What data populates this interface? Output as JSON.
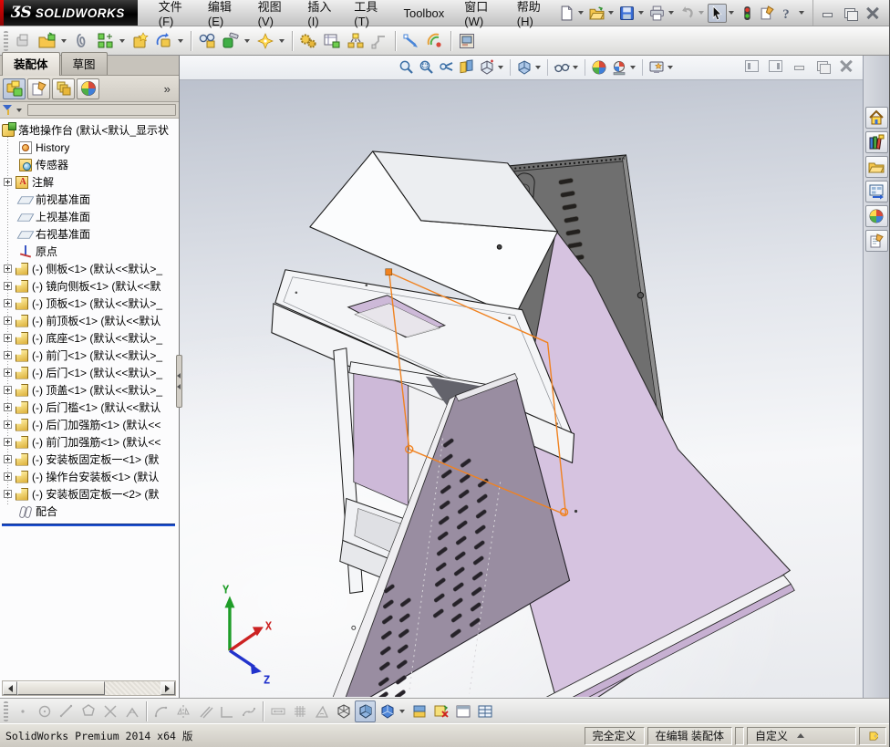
{
  "titlebar": {
    "logo_mark": "ƷS",
    "logo_text": "SOLIDWORKS",
    "menus": [
      "文件(F)",
      "编辑(E)",
      "视图(V)",
      "插入(I)",
      "工具(T)",
      "Toolbox",
      "窗口(W)",
      "帮助(H)"
    ]
  },
  "toolbars": {
    "standard": [
      "new-document",
      "open",
      "save",
      "print",
      "undo",
      "select",
      "rebuild",
      "file-properties",
      "help"
    ],
    "assembly": [
      "edit-component",
      "insert-components",
      "mate",
      "linear-component-pattern",
      "smart-fasteners",
      "move-component",
      "show-hidden-components",
      "assembly-features",
      "reference-geometry",
      "new-motion-study",
      "bill-of-materials",
      "exploded-view",
      "explode-line-sketch",
      "instant3d",
      "take-snapshot",
      "large-assembly-mode"
    ],
    "heads_up": [
      "zoom-to-fit",
      "zoom-to-area",
      "previous-view",
      "section-view",
      "view-orientation",
      "display-style",
      "hide-show-items",
      "edit-appearance",
      "apply-scene",
      "view-settings"
    ],
    "sketch_display": [
      "point",
      "circle",
      "line",
      "polygon",
      "trim-entities",
      "sketch-fillet",
      "tangent-arc",
      "mirror-entities",
      "offset-entities",
      "corner-rectangle",
      "spline",
      "smart-dimension",
      "grid-system",
      "measure",
      "wireframe",
      "shaded-with-edges",
      "view-cube",
      "section-view-toggle",
      "assembly-visualization",
      "task-pane-window",
      "split-table"
    ]
  },
  "command_tabs": [
    {
      "label": "装配体",
      "active": true
    },
    {
      "label": "草图",
      "active": false
    }
  ],
  "panel_more": "»",
  "panel_tabs": [
    "featuremanager-design-tree",
    "propertymanager",
    "configurationmanager",
    "displaymanager"
  ],
  "feature_tree": {
    "root_label": "落地操作台  (默认<默认_显示状",
    "items": [
      {
        "label": "History",
        "icon": "history"
      },
      {
        "label": "传感器",
        "icon": "sensors"
      },
      {
        "label": "注解",
        "icon": "annotations",
        "expandable": true
      },
      {
        "label": "前视基准面",
        "icon": "plane"
      },
      {
        "label": "上视基准面",
        "icon": "plane"
      },
      {
        "label": "右视基准面",
        "icon": "plane"
      },
      {
        "label": "原点",
        "icon": "origin"
      },
      {
        "label": "(-) 侧板<1> (默认<<默认>_",
        "icon": "part",
        "expandable": true
      },
      {
        "label": "(-) 镜向侧板<1> (默认<<默",
        "icon": "part",
        "expandable": true
      },
      {
        "label": "(-) 顶板<1> (默认<<默认>_",
        "icon": "part",
        "expandable": true
      },
      {
        "label": "(-) 前顶板<1> (默认<<默认",
        "icon": "part",
        "expandable": true
      },
      {
        "label": "(-) 底座<1> (默认<<默认>_",
        "icon": "part",
        "expandable": true
      },
      {
        "label": "(-) 前门<1> (默认<<默认>_",
        "icon": "part",
        "expandable": true
      },
      {
        "label": "(-) 后门<1> (默认<<默认>_",
        "icon": "part",
        "expandable": true
      },
      {
        "label": "(-) 顶盖<1> (默认<<默认>_",
        "icon": "part",
        "expandable": true
      },
      {
        "label": "(-) 后门槛<1> (默认<<默认",
        "icon": "part",
        "expandable": true
      },
      {
        "label": "(-) 后门加强筋<1> (默认<<",
        "icon": "part",
        "expandable": true
      },
      {
        "label": "(-) 前门加强筋<1> (默认<<",
        "icon": "part",
        "expandable": true
      },
      {
        "label": "(-) 安装板固定板一<1> (默",
        "icon": "part",
        "expandable": true
      },
      {
        "label": "(-) 操作台安装板<1> (默认",
        "icon": "part",
        "expandable": true
      },
      {
        "label": "(-) 安装板固定板一<2> (默",
        "icon": "part",
        "expandable": true
      },
      {
        "label": "配合",
        "icon": "mates"
      }
    ]
  },
  "task_pane": [
    "solidworks-resources",
    "design-library",
    "file-explorer",
    "view-palette",
    "appearances-scenes",
    "custom-properties"
  ],
  "viewport": {
    "triad": {
      "x": "X",
      "y": "Y",
      "z": "Z"
    }
  },
  "model": {
    "name": "落地操作台",
    "colors": {
      "side_panel": "#d6c3e0",
      "interior": "#cdb9d8",
      "rear_door": "#6f6f6f",
      "front_door": "#998da1",
      "body": "#fafbfc",
      "selection": "#f08220"
    }
  },
  "statusbar": {
    "product": "SolidWorks Premium 2014 x64 版",
    "define_state": "完全定义",
    "edit_state": "在编辑 装配体",
    "custom": "自定义"
  }
}
